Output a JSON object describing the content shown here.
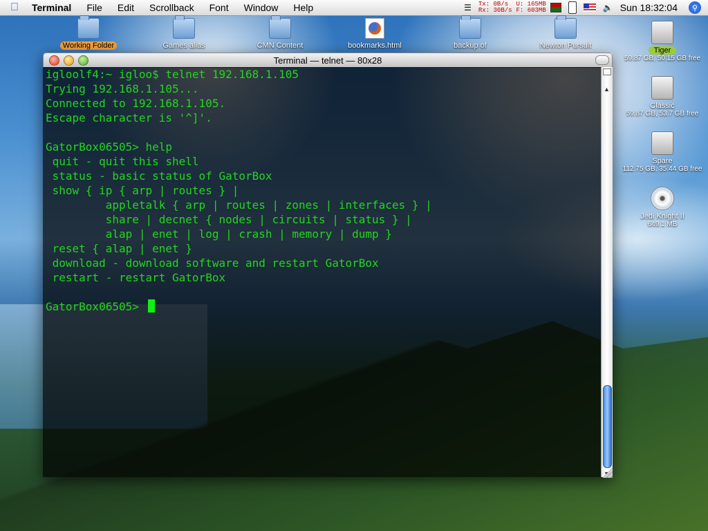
{
  "menubar": {
    "app": "Terminal",
    "items": [
      "File",
      "Edit",
      "Scrollback",
      "Font",
      "Window",
      "Help"
    ],
    "net": {
      "tx_label": "Tx:",
      "tx_value": "0B/s",
      "rx_label": "Rx:",
      "rx_value": "30B/s"
    },
    "mem": {
      "used": "U: 165MB",
      "free": "F: 603MB"
    },
    "clock": "Sun 18:32:04"
  },
  "desktop_icons": [
    {
      "label": "Working Folder",
      "type": "folder",
      "selected": true
    },
    {
      "label": "Games alias",
      "type": "folder",
      "selected": false
    },
    {
      "label": "CMN Content",
      "type": "folder",
      "selected": false
    },
    {
      "label": "bookmarks.html",
      "type": "firefox-document",
      "selected": false
    },
    {
      "label": "backup of",
      "type": "folder",
      "selected": false
    },
    {
      "label": "Newton Pursuit",
      "type": "folder",
      "selected": false
    }
  ],
  "disks": [
    {
      "name": "Tiger",
      "info": "59.87 GB, 50.15 GB free",
      "selected": true,
      "type": "hard-disk"
    },
    {
      "name": "Classic",
      "info": "59.87 GB, 53.7 GB free",
      "selected": false,
      "type": "hard-disk"
    },
    {
      "name": "Spare",
      "info": "112.75 GB, 35.44 GB free",
      "selected": false,
      "type": "hard-disk"
    },
    {
      "name": "Jedi Knight II",
      "info": "649.1 MB",
      "selected": false,
      "type": "cd"
    }
  ],
  "window": {
    "title": "Terminal — telnet — 80x28",
    "lines": [
      "igloolf4:~ igloo$ telnet 192.168.1.105",
      "Trying 192.168.1.105...",
      "Connected to 192.168.1.105.",
      "Escape character is '^]'.",
      "",
      "GatorBox06505> help",
      " quit - quit this shell",
      " status - basic status of GatorBox",
      " show { ip { arp | routes } |",
      "         appletalk { arp | routes | zones | interfaces } |",
      "         share | decnet { nodes | circuits | status } |",
      "         alap | enet | log | crash | memory | dump }",
      " reset { alap | enet }",
      " download - download software and restart GatorBox",
      " restart - restart GatorBox",
      "",
      "GatorBox06505> "
    ]
  }
}
